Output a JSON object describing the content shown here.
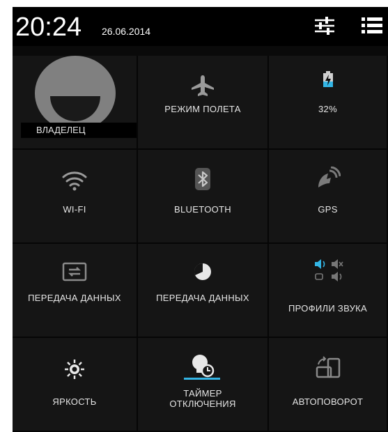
{
  "status_bar": {
    "time": "20:24",
    "date": "26.06.2014",
    "settings_icon": "sliders-icon",
    "list_icon": "list-icon"
  },
  "tiles": {
    "owner": {
      "label": "ВЛАДЕЛЕЦ",
      "icon": "avatar"
    },
    "airplane": {
      "label": "РЕЖИМ ПОЛЕТА",
      "icon": "airplane-icon"
    },
    "battery": {
      "label": "32%",
      "icon": "battery-charging-icon"
    },
    "wifi": {
      "label": "WI-FI",
      "icon": "wifi-icon"
    },
    "bluetooth": {
      "label": "BLUETOOTH",
      "icon": "bluetooth-icon"
    },
    "gps": {
      "label": "GPS",
      "icon": "gps-icon"
    },
    "data_transfer_1": {
      "label": "ПЕРЕДАЧА ДАННЫХ",
      "icon": "data-transfer-icon"
    },
    "data_transfer_2": {
      "label": "ПЕРЕДАЧА ДАННЫХ",
      "icon": "data-usage-icon"
    },
    "sound_profiles": {
      "label": "ПРОФИЛИ ЗВУКА",
      "icon": "sound-profiles-icon"
    },
    "brightness": {
      "label": "ЯРКОСТЬ",
      "icon": "brightness-icon"
    },
    "sleep_timer": {
      "label": "ТАЙМЕР ОТКЛЮЧЕНИЯ",
      "icon": "sleep-timer-icon"
    },
    "auto_rotate": {
      "label": "АВТОПОВОРОТ",
      "icon": "auto-rotate-icon"
    }
  },
  "colors": {
    "background": "#0a0a0a",
    "tile": "#151515",
    "accent": "#33b5e5",
    "text": "#e6e6e6"
  }
}
